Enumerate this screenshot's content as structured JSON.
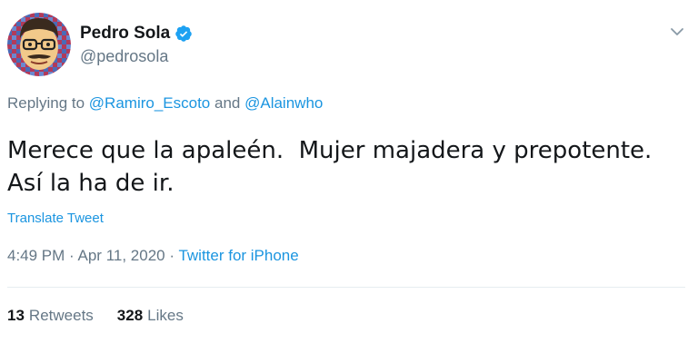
{
  "user": {
    "display_name": "Pedro Sola",
    "handle": "@pedrosola",
    "verified": true
  },
  "reply": {
    "prefix": "Replying to",
    "mention_1": "@Ramiro_Escoto",
    "joiner": "and",
    "mention_2": "@Alainwho"
  },
  "tweet": {
    "line_1": "Merece que la apaleén.  Mujer majadera y prepotente.",
    "line_2": "Así la ha de ir.",
    "translate_label": "Translate Tweet"
  },
  "meta": {
    "time": "4:49 PM",
    "separator_1": "·",
    "date": "Apr 11, 2020",
    "separator_2": "·",
    "source": "Twitter for iPhone"
  },
  "stats": {
    "retweets_count": "13",
    "retweets_label": "Retweets",
    "likes_count": "328",
    "likes_label": "Likes"
  },
  "icons": {
    "verified": "verified-badge-icon",
    "menu": "chevron-down-icon",
    "avatar": "avatar-illustration"
  },
  "colors": {
    "link": "#1b95e0",
    "secondary_text": "#657786",
    "primary_text": "#14171a",
    "verified_badge": "#1da1f2"
  }
}
